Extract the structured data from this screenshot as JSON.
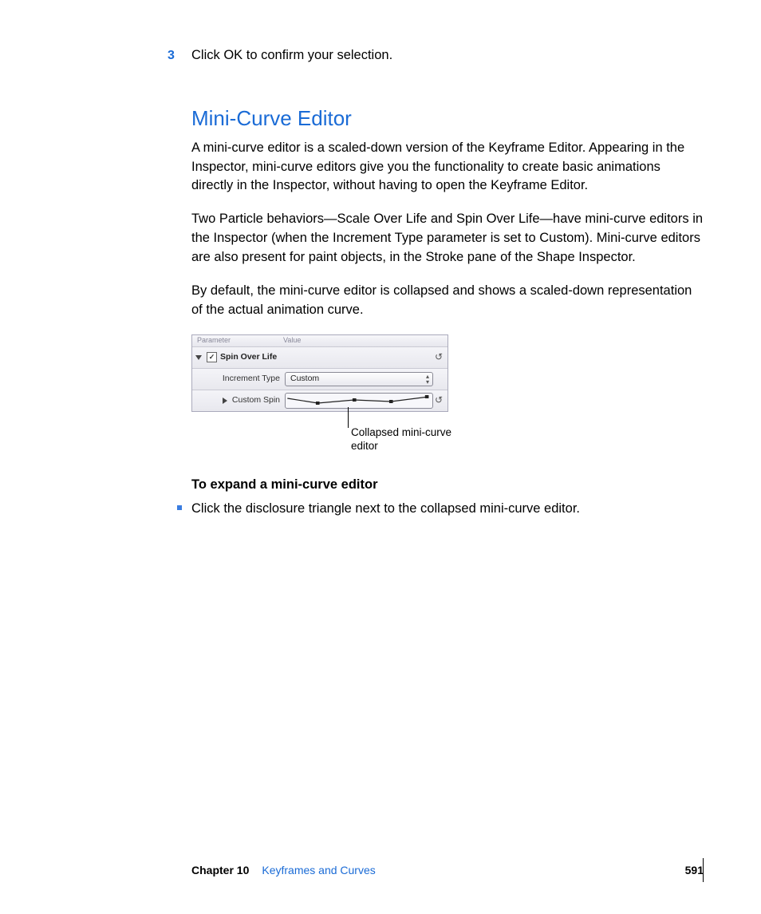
{
  "step": {
    "number": "3",
    "text": "Click OK to confirm your selection."
  },
  "section": {
    "heading": "Mini-Curve Editor",
    "p1": "A mini-curve editor is a scaled-down version of the Keyframe Editor. Appearing in the Inspector, mini-curve editors give you the functionality to create basic animations directly in the Inspector, without having to open the Keyframe Editor.",
    "p2": "Two Particle behaviors—Scale Over Life and Spin Over Life—have mini-curve editors in the Inspector (when the Increment Type parameter is set to Custom). Mini-curve editors are also present for paint objects, in the Stroke pane of the Shape Inspector.",
    "p3": "By default, the mini-curve editor is collapsed and shows a scaled-down representation of the actual animation curve."
  },
  "figure": {
    "header_param": "Parameter",
    "header_value": "Value",
    "row1_label": "Spin Over Life",
    "row2_label": "Increment Type",
    "row2_value": "Custom",
    "row3_label": "Custom Spin",
    "callout": "Collapsed mini-curve editor"
  },
  "task": {
    "heading": "To expand a mini-curve editor",
    "bullet": "Click the disclosure triangle next to the collapsed mini-curve editor."
  },
  "footer": {
    "chapter": "Chapter 10",
    "title": "Keyframes and Curves",
    "page": "591"
  }
}
